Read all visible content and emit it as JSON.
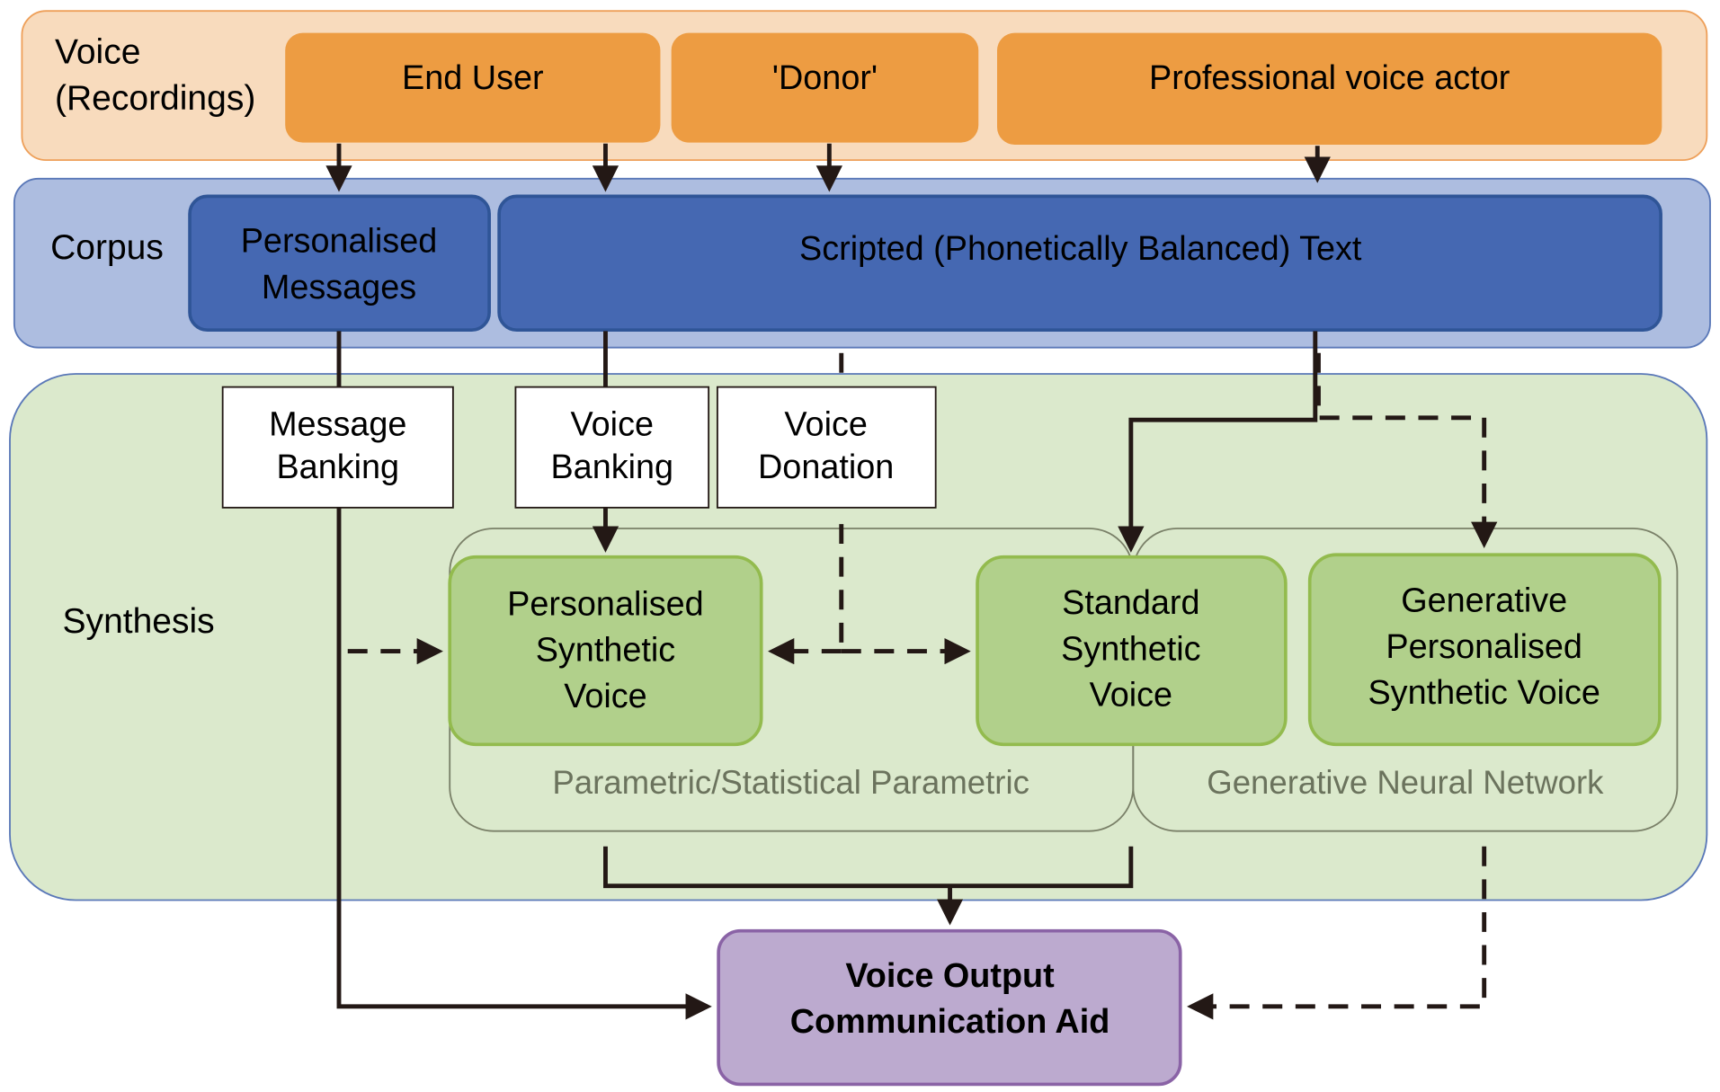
{
  "bands": {
    "voice": {
      "label_line1": "Voice",
      "label_line2": "(Recordings)",
      "fill": "#f8dbbd",
      "stroke": "#eea05a"
    },
    "corpus": {
      "label": "Corpus",
      "fill": "#adbde0",
      "stroke": "#5a78b8"
    },
    "synthesis": {
      "label": "Synthesis",
      "fill": "#dbe9cc",
      "stroke": "#5a78b8"
    }
  },
  "voice_sources": [
    {
      "label": "End User"
    },
    {
      "label": "'Donor'"
    },
    {
      "label": "Professional voice actor"
    }
  ],
  "corpus_boxes": {
    "personalised_messages": {
      "line1": "Personalised",
      "line2": "Messages"
    },
    "scripted_text": {
      "label": "Scripted (Phonetically Balanced) Text"
    }
  },
  "processes": {
    "message_banking": {
      "line1": "Message",
      "line2": "Banking"
    },
    "voice_banking": {
      "line1": "Voice",
      "line2": "Banking"
    },
    "voice_donation": {
      "line1": "Voice",
      "line2": "Donation"
    }
  },
  "synthesis_groups": {
    "parametric": {
      "label": "Parametric/Statistical Parametric"
    },
    "neural": {
      "label": "Generative Neural Network"
    }
  },
  "voices": {
    "personalised": {
      "line1": "Personalised",
      "line2": "Synthetic",
      "line3": "Voice"
    },
    "standard": {
      "line1": "Standard",
      "line2": "Synthetic",
      "line3": "Voice"
    },
    "generative": {
      "line1": "Generative",
      "line2": "Personalised",
      "line3": "Synthetic Voice"
    }
  },
  "output": {
    "line1": "Voice Output",
    "line2": "Communication Aid",
    "fill": "#bcaacf",
    "stroke": "#8a63a6"
  },
  "colors": {
    "orange": "#ed9c42",
    "blue": "#4568b2",
    "green": "#b1d08b",
    "green_stroke": "#93bb4e"
  }
}
